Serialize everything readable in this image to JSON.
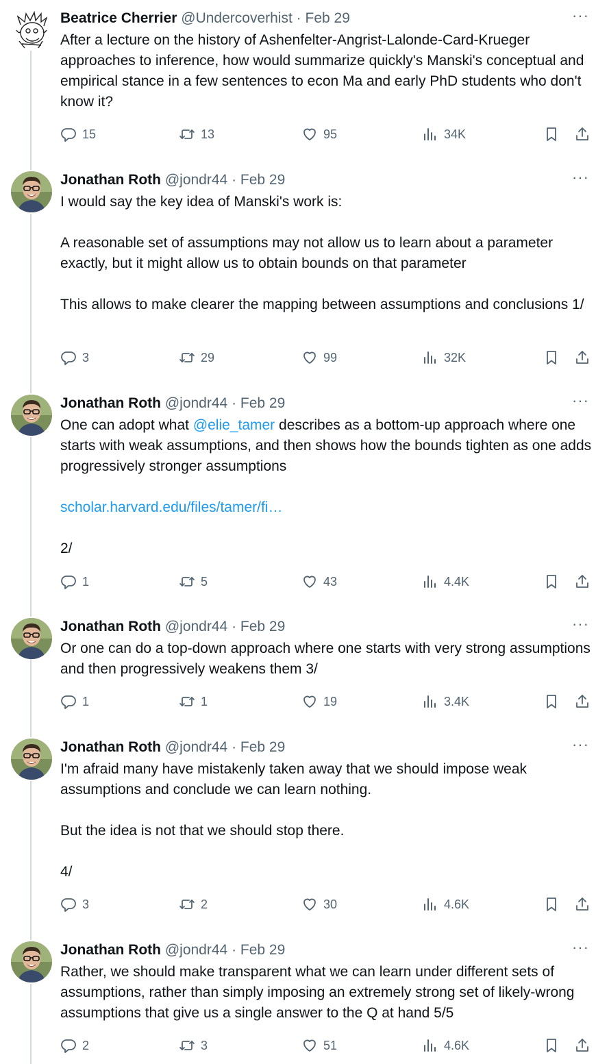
{
  "thread": [
    {
      "name": "Beatrice Cherrier",
      "handle": "@Undercoverhist",
      "separator": "·",
      "date": "Feb 29",
      "avatar": "sketch-avatar",
      "paragraphs": [
        [
          "After a lecture on the history of Ashenfelter-Angrist-Lalonde-Card-Krueger approaches to inference, how would summarize quickly's Manski's conceptual and empirical stance in a few sentences to econ Ma and early PhD students who don't know it?"
        ]
      ],
      "replies": "15",
      "retweets": "13",
      "likes": "95",
      "views": "34K"
    },
    {
      "name": "Jonathan Roth",
      "handle": "@jondr44",
      "separator": "·",
      "date": "Feb 29",
      "avatar": "photo-avatar",
      "paragraphs": [
        [
          "I would say the key idea of Manski's work is:"
        ],
        [
          "A reasonable set of assumptions may not allow us to learn about a parameter exactly, but it might allow us to obtain bounds on that parameter"
        ],
        [
          "This allows to make clearer the mapping between assumptions and conclusions 1/"
        ]
      ],
      "replies": "3",
      "retweets": "29",
      "likes": "99",
      "views": "32K"
    },
    {
      "name": "Jonathan Roth",
      "handle": "@jondr44",
      "separator": "·",
      "date": "Feb 29",
      "avatar": "photo-avatar",
      "text_prefix": "One can adopt what ",
      "mention": "@elie_tamer",
      "text_suffix": " describes as a bottom-up approach where one starts with weak assumptions, and then shows how the bounds tighten as one adds progressively stronger assumptions",
      "url": "scholar.harvard.edu/files/tamer/fi…",
      "tail": "2/",
      "replies": "1",
      "retweets": "5",
      "likes": "43",
      "views": "4.4K"
    },
    {
      "name": "Jonathan Roth",
      "handle": "@jondr44",
      "separator": "·",
      "date": "Feb 29",
      "avatar": "photo-avatar",
      "paragraphs": [
        [
          "Or one can do a top-down approach where one starts with very strong assumptions and then progressively weakens them 3/"
        ]
      ],
      "replies": "1",
      "retweets": "1",
      "likes": "19",
      "views": "3.4K"
    },
    {
      "name": "Jonathan Roth",
      "handle": "@jondr44",
      "separator": "·",
      "date": "Feb 29",
      "avatar": "photo-avatar",
      "paragraphs": [
        [
          "I'm afraid many have mistakenly taken away that we should impose weak assumptions and conclude we can learn nothing."
        ],
        [
          "But the idea is not that we should stop there."
        ],
        [
          "4/"
        ]
      ],
      "replies": "3",
      "retweets": "2",
      "likes": "30",
      "views": "4.6K"
    },
    {
      "name": "Jonathan Roth",
      "handle": "@jondr44",
      "separator": "·",
      "date": "Feb 29",
      "avatar": "photo-avatar",
      "paragraphs": [
        [
          "Rather, we should make transparent what we can learn under different sets of assumptions, rather than simply imposing an extremely strong set of likely-wrong assumptions that give us a single answer to the Q at hand 5/5"
        ]
      ],
      "replies": "2",
      "retweets": "3",
      "likes": "51",
      "views": "4.6K"
    }
  ],
  "more_label": "···",
  "colors": {
    "text": "#0f1419",
    "secondary": "#536471",
    "link": "#1d9bf0",
    "thread_line": "#cfd9de"
  }
}
